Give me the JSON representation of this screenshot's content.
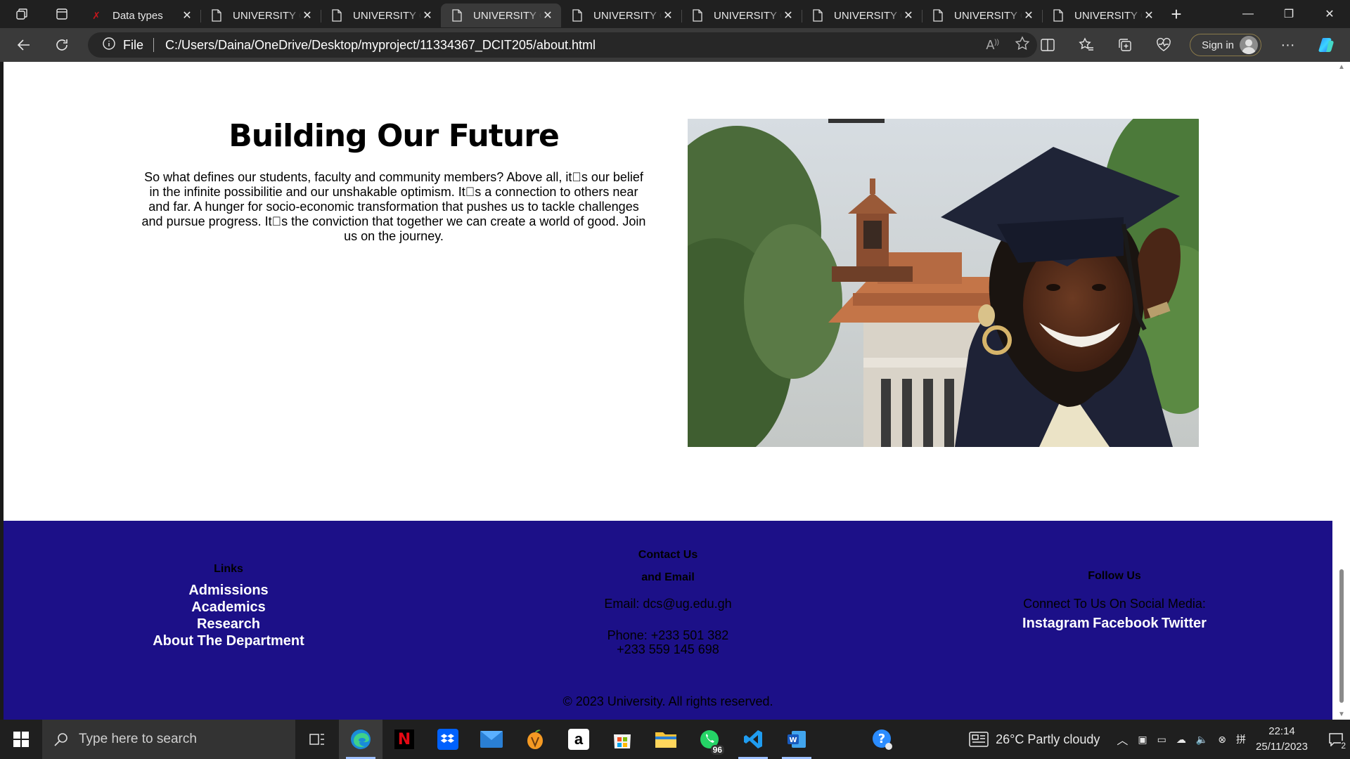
{
  "browser": {
    "tabs": [
      {
        "title": "Data types",
        "favicon": "red-x-icon",
        "active": false
      },
      {
        "title": "UNIVERSITY OF GHANA",
        "favicon": "page-icon",
        "active": false
      },
      {
        "title": "UNIVERSITY OF GHANA",
        "favicon": "page-icon",
        "active": false
      },
      {
        "title": "UNIVERSITY OF GHANA",
        "favicon": "page-icon",
        "active": true
      },
      {
        "title": "UNIVERSITY OF GHANA",
        "favicon": "page-icon",
        "active": false
      },
      {
        "title": "UNIVERSITY OF GHANA",
        "favicon": "page-icon",
        "active": false
      },
      {
        "title": "UNIVERSITY OF GHANA",
        "favicon": "page-icon",
        "active": false
      },
      {
        "title": "UNIVERSITY OF GHANA",
        "favicon": "page-icon",
        "active": false
      },
      {
        "title": "UNIVERSITY OF GHANA",
        "favicon": "page-icon",
        "active": false
      }
    ],
    "address": {
      "scheme_label": "File",
      "url": "C:/Users/Daina/OneDrive/Desktop/myproject/11334367_DCIT205/about.html"
    },
    "signin_label": "Sign in"
  },
  "page": {
    "hero": {
      "heading": "Building Our Future",
      "text": "So what defines our students, faculty and community members? Above all, it\u0000s our belief in the infinite possibilitie and our unshakable optimism. It\u0000s a connection to others near and far. A hunger for socio-economic transformation that pushes us to tackle challenges and pursue progress. It\u0000s the conviction that together we can create a world of good. Join us on the journey."
    },
    "footer": {
      "links": {
        "heading": "Links",
        "items": [
          "Admissions",
          "Academics",
          "Research",
          "About The Department"
        ]
      },
      "contact": {
        "heading_line1": "Contact Us",
        "heading_line2": "and Email",
        "email": "Email: dcs@ug.edu.gh",
        "phone1": "Phone: +233 501 382",
        "phone2": "+233 559 145 698"
      },
      "follow": {
        "heading": "Follow Us",
        "subtitle": "Connect To Us On Social Media:",
        "social": [
          "Instagram",
          "Facebook",
          "Twitter"
        ]
      },
      "copyright": "© 2023 University. All rights reserved."
    }
  },
  "taskbar": {
    "search_placeholder": "Type here to search",
    "whatsapp_badge": "96",
    "weather": "26°C  Partly cloudy",
    "time": "22:14",
    "date": "25/11/2023",
    "notifications": "2"
  },
  "colors": {
    "footer_bg": "#1c1088",
    "browser_chrome": "#202020",
    "toolbar": "#3a3a3a"
  }
}
